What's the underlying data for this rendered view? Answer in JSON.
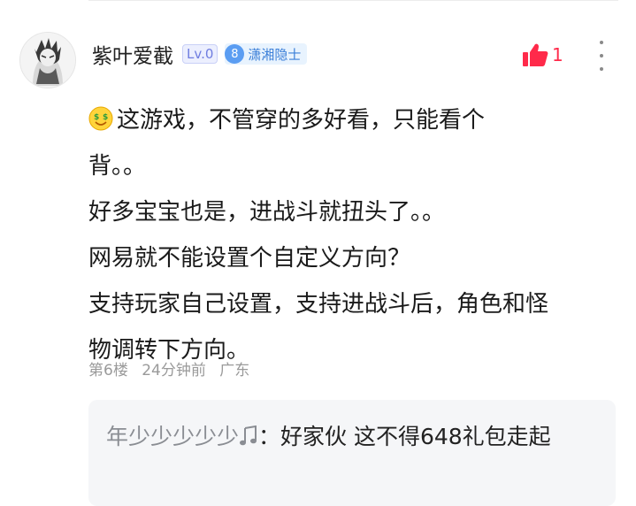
{
  "comment": {
    "username": "紫叶爱截",
    "level": "Lv.0",
    "title_level": "8",
    "title": "潇湘隐士",
    "like_count": "1",
    "body_lines": [
      "这游戏，不管穿的多好看，只能看个",
      "背。。",
      "好多宝宝也是，进战斗就扭头了。。",
      "网易就不能设置个自定义方向？",
      "支持玩家自己设置，支持进战斗后，角色和怪",
      "物调转下方向。"
    ],
    "floor": "第6楼",
    "time": "24分钟前",
    "location": "广东"
  },
  "reply": {
    "name": "年少少少少少",
    "text": "：好家伙 这不得648礼包走起"
  },
  "colors": {
    "like": "#ff2a4a",
    "level_badge": "#6f7de0",
    "title_badge": "#3b7fd8",
    "meta": "#9a9a9a"
  },
  "icons": {
    "like": "thumbs-up-icon",
    "more": "more-vertical-icon",
    "emoji": "money-face-emoji-icon",
    "music": "music-note-icon"
  }
}
